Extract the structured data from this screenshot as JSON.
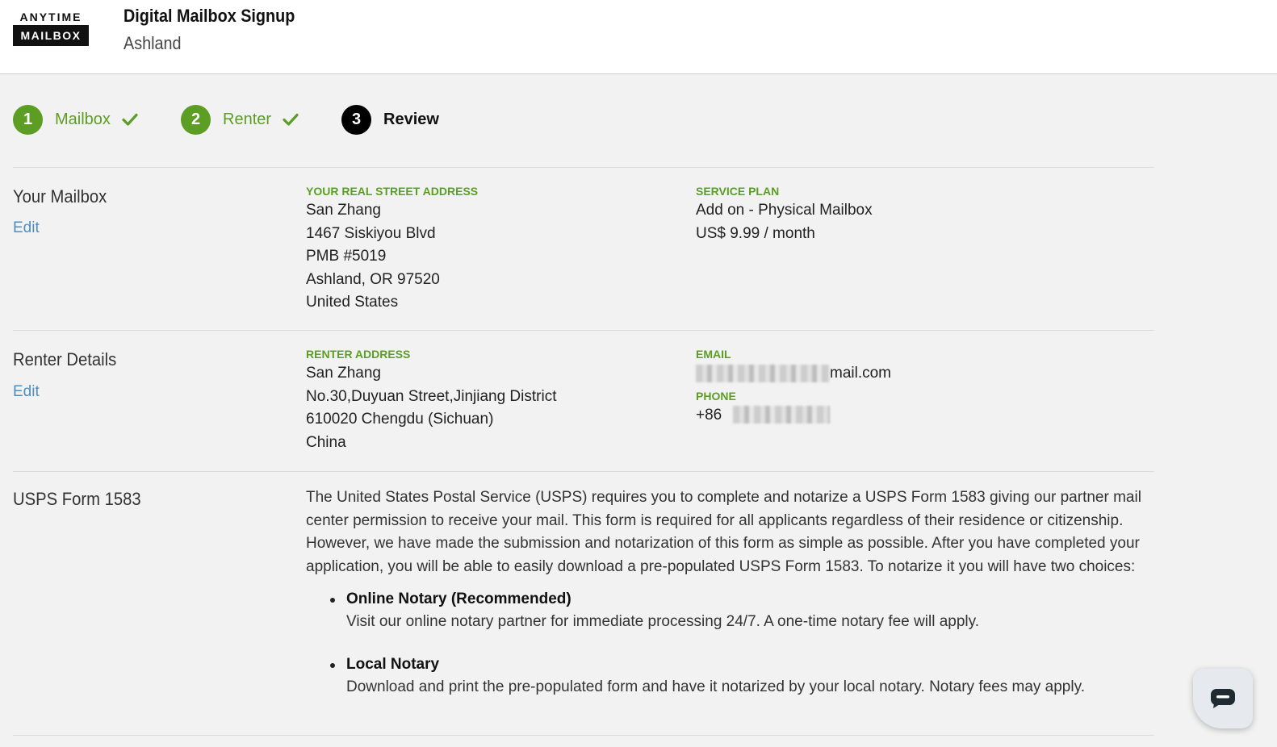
{
  "header": {
    "logo_top": "ANYTIME",
    "logo_bottom": "MAILBOX",
    "title": "Digital Mailbox Signup",
    "subtitle": "Ashland"
  },
  "steps": [
    {
      "number": "1",
      "label": "Mailbox",
      "status": "done"
    },
    {
      "number": "2",
      "label": "Renter",
      "status": "done"
    },
    {
      "number": "3",
      "label": "Review",
      "status": "current"
    }
  ],
  "colors": {
    "accent_green": "#5c9e24",
    "link_blue": "#4f8ec0",
    "current_step": "#000000"
  },
  "mailbox": {
    "title": "Your Mailbox",
    "edit_label": "Edit",
    "address_label": "YOUR REAL STREET ADDRESS",
    "address_lines": [
      "San Zhang",
      "1467 Siskiyou Blvd",
      "PMB #5019",
      "Ashland, OR 97520",
      "United States"
    ],
    "plan_label": "SERVICE PLAN",
    "plan_lines": [
      "Add on - Physical Mailbox",
      "US$ 9.99 / month"
    ]
  },
  "renter": {
    "title": "Renter Details",
    "edit_label": "Edit",
    "address_label": "RENTER ADDRESS",
    "address_lines": [
      "San Zhang",
      "No.30,Duyuan Street,Jinjiang District",
      "610020 Chengdu (Sichuan)",
      "China"
    ],
    "email_label": "EMAIL",
    "email_visible": "mail.com",
    "phone_label": "PHONE",
    "phone_prefix": "+86"
  },
  "usps": {
    "title": "USPS Form 1583",
    "paragraph": "The United States Postal Service (USPS) requires you to complete and notarize a USPS Form 1583 giving our partner mail center permission to receive your mail. This form is required for all applicants regardless of their residence or citizenship. However, we have made the submission and notarization of this form as simple as possible. After you have completed your application, you will be able to easily download a pre-populated USPS Form 1583. To notarize it you will have two choices:",
    "choices": [
      {
        "title": "Online Notary (Recommended)",
        "desc": "Visit our online notary partner for immediate processing 24/7. A one-time notary fee will apply."
      },
      {
        "title": "Local Notary",
        "desc": "Download and print the pre-populated form and have it notarized by your local notary. Notary fees may apply."
      }
    ]
  },
  "chat": {
    "icon": "chat-bubble-icon"
  }
}
